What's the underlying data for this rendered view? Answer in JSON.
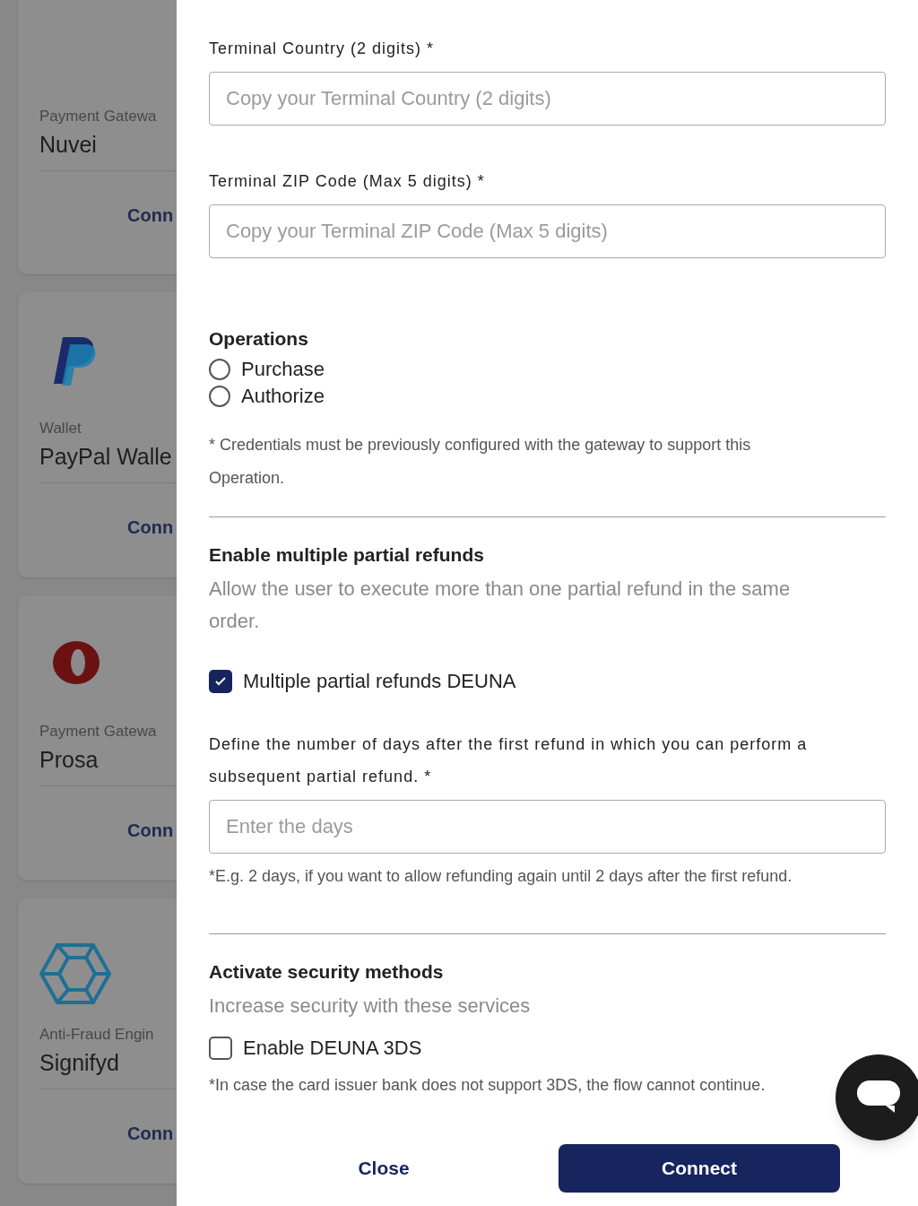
{
  "background_cards": [
    {
      "category": "Payment Gatewa",
      "name": "Nuvei",
      "action": "Conn"
    },
    {
      "kind": "p-logo",
      "category": "Wallet",
      "name": "PayPal Walle",
      "action": "Conn"
    },
    {
      "kind": "ring-logo",
      "category": "Payment Gatewa",
      "name": "Prosa",
      "action": "Conn"
    },
    {
      "kind": "hexagon-logo",
      "category": "Anti-Fraud Engin",
      "name": "Signifyd",
      "action": "Conn"
    }
  ],
  "fields": [
    {
      "label": "Terminal Country (2 digits) *",
      "placeholder": "Copy your Terminal Country (2 digits)"
    },
    {
      "label": "Terminal ZIP Code (Max 5 digits) *",
      "placeholder": "Copy your Terminal ZIP Code (Max 5 digits)"
    }
  ],
  "operations": {
    "title": "Operations",
    "options": [
      {
        "label": "Purchase",
        "selected": false
      },
      {
        "label": "Authorize",
        "selected": false
      }
    ],
    "note": "* Credentials must be previously configured with the gateway to support this Operation."
  },
  "refunds": {
    "title": "Enable multiple partial refunds",
    "description": "Allow the user to execute more than one partial refund in the same order.",
    "checkbox": {
      "label": "Multiple partial refunds DEUNA",
      "checked": true
    },
    "days_field": {
      "label": "Define the number of days after the first refund in which you can perform a subsequent partial refund. *",
      "placeholder": "Enter the days",
      "hint": "*E.g. 2 days, if you want to allow refunding again until 2 days after the first refund."
    }
  },
  "security": {
    "title": "Activate security methods",
    "description": "Increase security with these services",
    "checkbox": {
      "label": "Enable DEUNA 3DS",
      "checked": false
    },
    "note": "*In case the card issuer bank does not support 3DS, the flow cannot continue."
  },
  "footer": {
    "close": "Close",
    "connect": "Connect"
  }
}
